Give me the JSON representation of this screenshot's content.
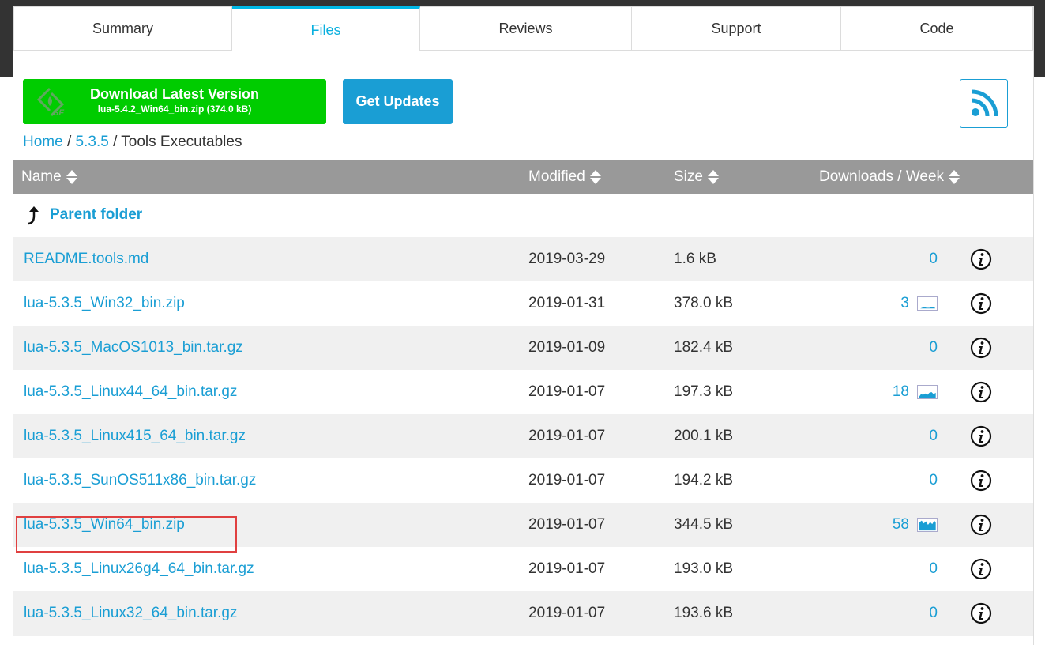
{
  "tabs": [
    {
      "label": "Summary",
      "active": false
    },
    {
      "label": "Files",
      "active": true
    },
    {
      "label": "Reviews",
      "active": false
    },
    {
      "label": "Support",
      "active": false
    },
    {
      "label": "Code",
      "active": false
    }
  ],
  "download": {
    "title": "Download Latest Version",
    "subtitle": "lua-5.4.2_Win64_bin.zip (374.0 kB)",
    "logo_icon": "sourceforge-logo-icon"
  },
  "get_updates_label": "Get Updates",
  "rss_icon": "rss-icon",
  "breadcrumb": {
    "home": "Home",
    "sep1": "/",
    "version": "5.3.5",
    "sep2": "/",
    "current": "Tools Executables"
  },
  "table": {
    "headers": {
      "name": "Name",
      "modified": "Modified",
      "size": "Size",
      "downloads": "Downloads / Week"
    },
    "parent_folder": "Parent folder",
    "rows": [
      {
        "name": "README.tools.md",
        "modified": "2019-03-29",
        "size": "1.6 kB",
        "downloads": "0",
        "spark": 0
      },
      {
        "name": "lua-5.3.5_Win32_bin.zip",
        "modified": "2019-01-31",
        "size": "378.0 kB",
        "downloads": "3",
        "spark": 1
      },
      {
        "name": "lua-5.3.5_MacOS1013_bin.tar.gz",
        "modified": "2019-01-09",
        "size": "182.4 kB",
        "downloads": "0",
        "spark": 0
      },
      {
        "name": "lua-5.3.5_Linux44_64_bin.tar.gz",
        "modified": "2019-01-07",
        "size": "197.3 kB",
        "downloads": "18",
        "spark": 2
      },
      {
        "name": "lua-5.3.5_Linux415_64_bin.tar.gz",
        "modified": "2019-01-07",
        "size": "200.1 kB",
        "downloads": "0",
        "spark": 0
      },
      {
        "name": "lua-5.3.5_SunOS511x86_bin.tar.gz",
        "modified": "2019-01-07",
        "size": "194.2 kB",
        "downloads": "0",
        "spark": 0
      },
      {
        "name": "lua-5.3.5_Win64_bin.zip",
        "modified": "2019-01-07",
        "size": "344.5 kB",
        "downloads": "58",
        "spark": 3
      },
      {
        "name": "lua-5.3.5_Linux26g4_64_bin.tar.gz",
        "modified": "2019-01-07",
        "size": "193.0 kB",
        "downloads": "0",
        "spark": 0
      },
      {
        "name": "lua-5.3.5_Linux32_64_bin.tar.gz",
        "modified": "2019-01-07",
        "size": "193.6 kB",
        "downloads": "0",
        "spark": 0
      }
    ]
  },
  "colors": {
    "accent": "#1a9ed4",
    "download_green": "#00cc00",
    "header_gray": "#999999",
    "highlight": "#e04040"
  }
}
